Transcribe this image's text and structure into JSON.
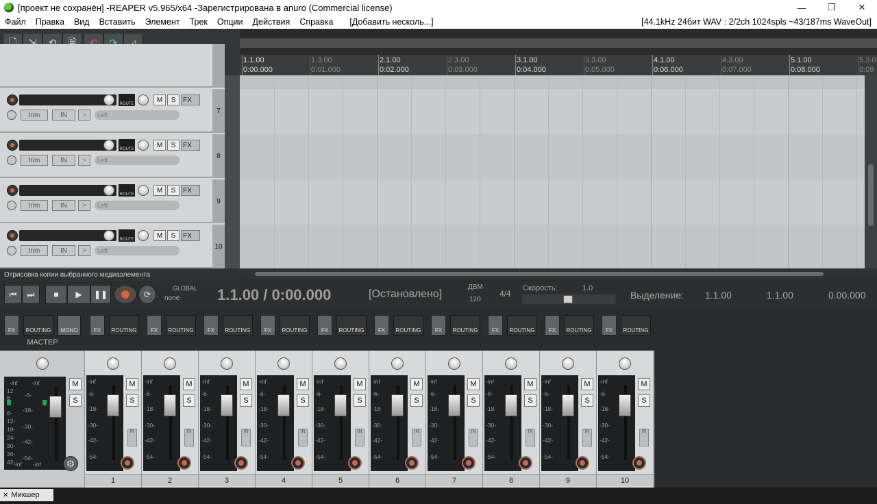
{
  "window": {
    "title": "[проект не сохранён] -REAPER v5.965/x64 -Зарегистрирована в anuro (Commercial license)",
    "controls": {
      "minimize": "—",
      "maximize": "❐",
      "close": "✕"
    }
  },
  "menu": {
    "items": [
      "Файл",
      "Правка",
      "Вид",
      "Вставить",
      "Элемент",
      "Трек",
      "Опции",
      "Действия",
      "Справка",
      "[Добавить несколь...]"
    ],
    "status": "[44.1kHz 24бит WAV : 2/2ch 1024spls ~43/187ms WaveOut]"
  },
  "ruler": {
    "marks": [
      {
        "bar": "1.1.00",
        "time": "0:00.000",
        "major": true
      },
      {
        "bar": "1.3.00",
        "time": "0:01.000",
        "major": false
      },
      {
        "bar": "2.1.00",
        "time": "0:02.000",
        "major": true
      },
      {
        "bar": "2.3.00",
        "time": "0:03.000",
        "major": false
      },
      {
        "bar": "3.1.00",
        "time": "0:04.000",
        "major": true
      },
      {
        "bar": "3.3.00",
        "time": "0:05.000",
        "major": false
      },
      {
        "bar": "4.1.00",
        "time": "0:06.000",
        "major": true
      },
      {
        "bar": "4.3.00",
        "time": "0:07.000",
        "major": false
      },
      {
        "bar": "5.1.00",
        "time": "0:08.000",
        "major": true
      },
      {
        "bar": "5.3.0",
        "time": "0:09",
        "major": false
      }
    ]
  },
  "tracks": [
    {
      "number": "7",
      "trim": "trim",
      "in": "IN",
      "route": "ROUTE",
      "mute": "M",
      "solo": "S",
      "fx": "FX",
      "input": "Left"
    },
    {
      "number": "8",
      "trim": "trim",
      "in": "IN",
      "route": "ROUTE",
      "mute": "M",
      "solo": "S",
      "fx": "FX",
      "input": "Left"
    },
    {
      "number": "9",
      "trim": "trim",
      "in": "IN",
      "route": "ROUTE",
      "mute": "M",
      "solo": "S",
      "fx": "FX",
      "input": "Left"
    },
    {
      "number": "10",
      "trim": "trim",
      "in": "IN",
      "route": "ROUTE",
      "mute": "M",
      "solo": "S",
      "fx": "FX",
      "input": "Left"
    }
  ],
  "statusline": "Отрисовка копии выбранного медиаэлемента",
  "transport": {
    "global_label": "GLOBAL",
    "global_value": "none",
    "position": "1.1.00 / 0:00.000",
    "state": "[Остановлено]",
    "bpm_label": "ДВМ",
    "bpm_value": "120",
    "time_sig": "4/4",
    "rate_label": "Скорость:",
    "rate_value": "1.0",
    "selection_label": "Выделение:",
    "sel_start": "1.1.00",
    "sel_end": "1.1.00",
    "sel_len": "0.00.000"
  },
  "mixer": {
    "master_label": "МАСТЕР",
    "master_mono": "MONO",
    "fx_label": "FX",
    "routing_label": "ROUTING",
    "mute": "M",
    "solo": "S",
    "in_label": "IN",
    "meter_top": "-inf",
    "scale": [
      "-6-",
      "-18-",
      "-30-",
      "-42-",
      "-54-"
    ],
    "master_scale": [
      "12",
      "6",
      "6-",
      "12-",
      "18-",
      "24-",
      "30-",
      "36-",
      "42-",
      "-inf"
    ],
    "channels": [
      "1",
      "2",
      "3",
      "4",
      "5",
      "6",
      "7",
      "8",
      "9",
      "10"
    ]
  },
  "bottom": {
    "tab": "Микшер"
  }
}
